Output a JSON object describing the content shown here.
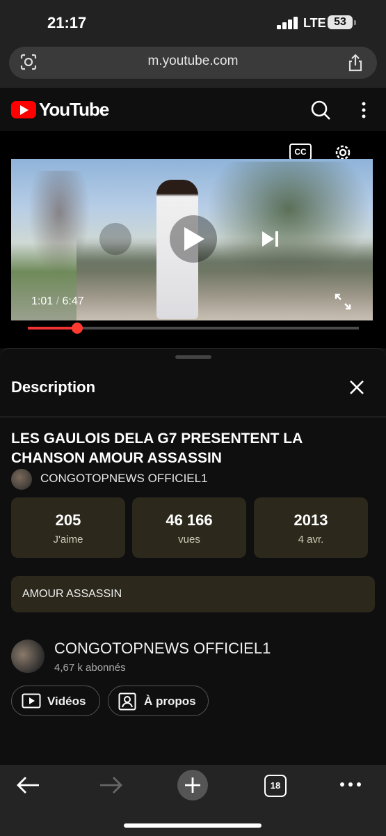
{
  "status_bar": {
    "time": "21:17",
    "network": "LTE",
    "battery": "53"
  },
  "browser": {
    "url": "m.youtube.com",
    "tab_count": "18"
  },
  "youtube": {
    "logo_text": "YouTube"
  },
  "player": {
    "current_time": "1:01",
    "duration": "6:47",
    "progress": 0.15,
    "cc_label": "CC"
  },
  "description": {
    "heading": "Description",
    "video_title": "LES GAULOIS DELA G7 PRESENTENT LA CHANSON AMOUR ASSASSIN",
    "channel": "CONGOTOPNEWS OFFICIEL1",
    "stats": [
      {
        "value": "205",
        "label": "J'aime"
      },
      {
        "value": "46 166",
        "label": "vues"
      },
      {
        "value": "2013",
        "label": "4 avr."
      }
    ],
    "text": "AMOUR ASSASSIN",
    "channel_card": {
      "name": "CONGOTOPNEWS OFFICIEL1",
      "subscribers": "4,67 k abonnés",
      "buttons": [
        {
          "label": "Vidéos",
          "icon": "play-box-icon"
        },
        {
          "label": "À propos",
          "icon": "person-box-icon"
        }
      ]
    }
  },
  "colors": {
    "accent": "#ff0000",
    "chip_bg": "#2c291c",
    "progress": "#ff3b30"
  }
}
